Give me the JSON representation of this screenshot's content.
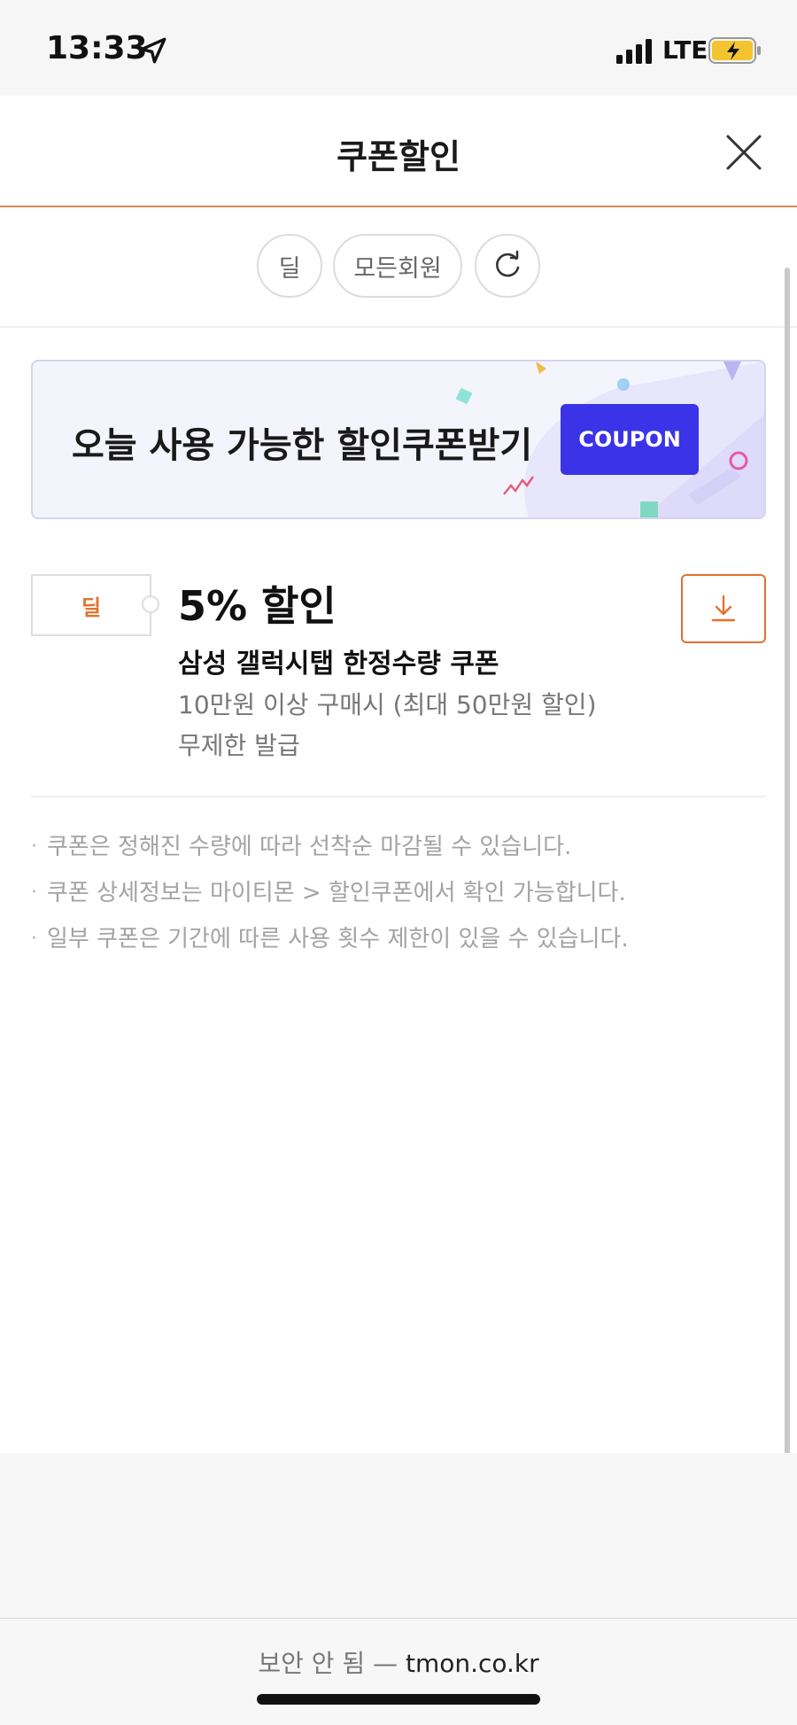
{
  "status_bar": {
    "time": "13:33",
    "network": "LTE",
    "icons": [
      "location-arrow-icon",
      "signal-bars-icon",
      "battery-charging-icon"
    ]
  },
  "header": {
    "title": "쿠폰할인",
    "close_icon": "close-icon"
  },
  "filters": {
    "deal_label": "딜",
    "member_label": "모든회원",
    "refresh_icon": "refresh-icon"
  },
  "banner": {
    "text": "오늘 사용 가능한 할인쿠폰받기",
    "coupon_button": "COUPON",
    "colors": {
      "accent": "#3a33e8",
      "background": "#f4f4fd"
    }
  },
  "coupon": {
    "tag": "딜",
    "discount": "5% 할인",
    "name": "삼성 갤럭시탭 한정수량 쿠폰",
    "condition": "10만원 이상 구매시 (최대 50만원 할인)",
    "limit": "무제한 발급",
    "download_icon": "download-icon",
    "accent_color": "#e0722f"
  },
  "notes": [
    "쿠폰은 정해진 수량에 따라 선착순 마감될 수 있습니다.",
    "쿠폰 상세정보는 마이티몬 > 할인쿠폰에서 확인 가능합니다.",
    "일부 쿠폰은 기간에 따른 사용 횟수 제한이 있을 수 있습니다."
  ],
  "browser": {
    "security_label": "보안 안 됨 —",
    "domain": "tmon.co.kr"
  }
}
